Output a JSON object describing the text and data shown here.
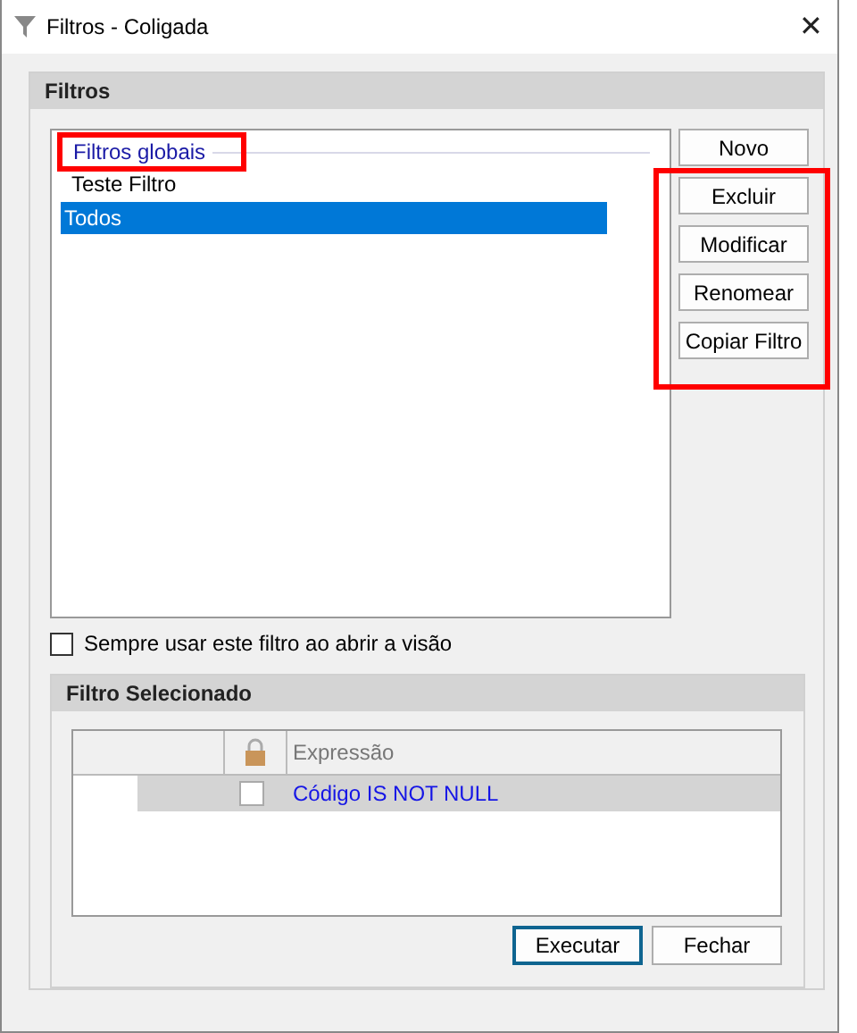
{
  "window": {
    "title": "Filtros - Coligada",
    "close": "✕"
  },
  "filters_panel": {
    "title": "Filtros",
    "list": {
      "group_label": "Filtros globais",
      "group_highlighted": true,
      "items": [
        {
          "label": "Teste Filtro",
          "selected": false
        },
        {
          "label": "Todos",
          "selected": true
        }
      ]
    },
    "buttons": [
      {
        "label": "Novo",
        "highlighted": false
      },
      {
        "label": "Excluir",
        "highlighted": true
      },
      {
        "label": "Modificar",
        "highlighted": true
      },
      {
        "label": "Renomear",
        "highlighted": true
      },
      {
        "label": "Copiar Filtro",
        "highlighted": true
      }
    ],
    "always_use": {
      "label": "Sempre usar este filtro ao abrir a visão",
      "checked": false
    }
  },
  "selected_panel": {
    "title": "Filtro Selecionado",
    "grid": {
      "columns": [
        "Expressão"
      ],
      "rows": [
        {
          "locked": false,
          "expression": "Código IS NOT NULL",
          "selected": true
        }
      ]
    }
  },
  "footer_buttons": [
    {
      "label": "Executar",
      "default": true
    },
    {
      "label": "Fechar",
      "default": false
    }
  ]
}
